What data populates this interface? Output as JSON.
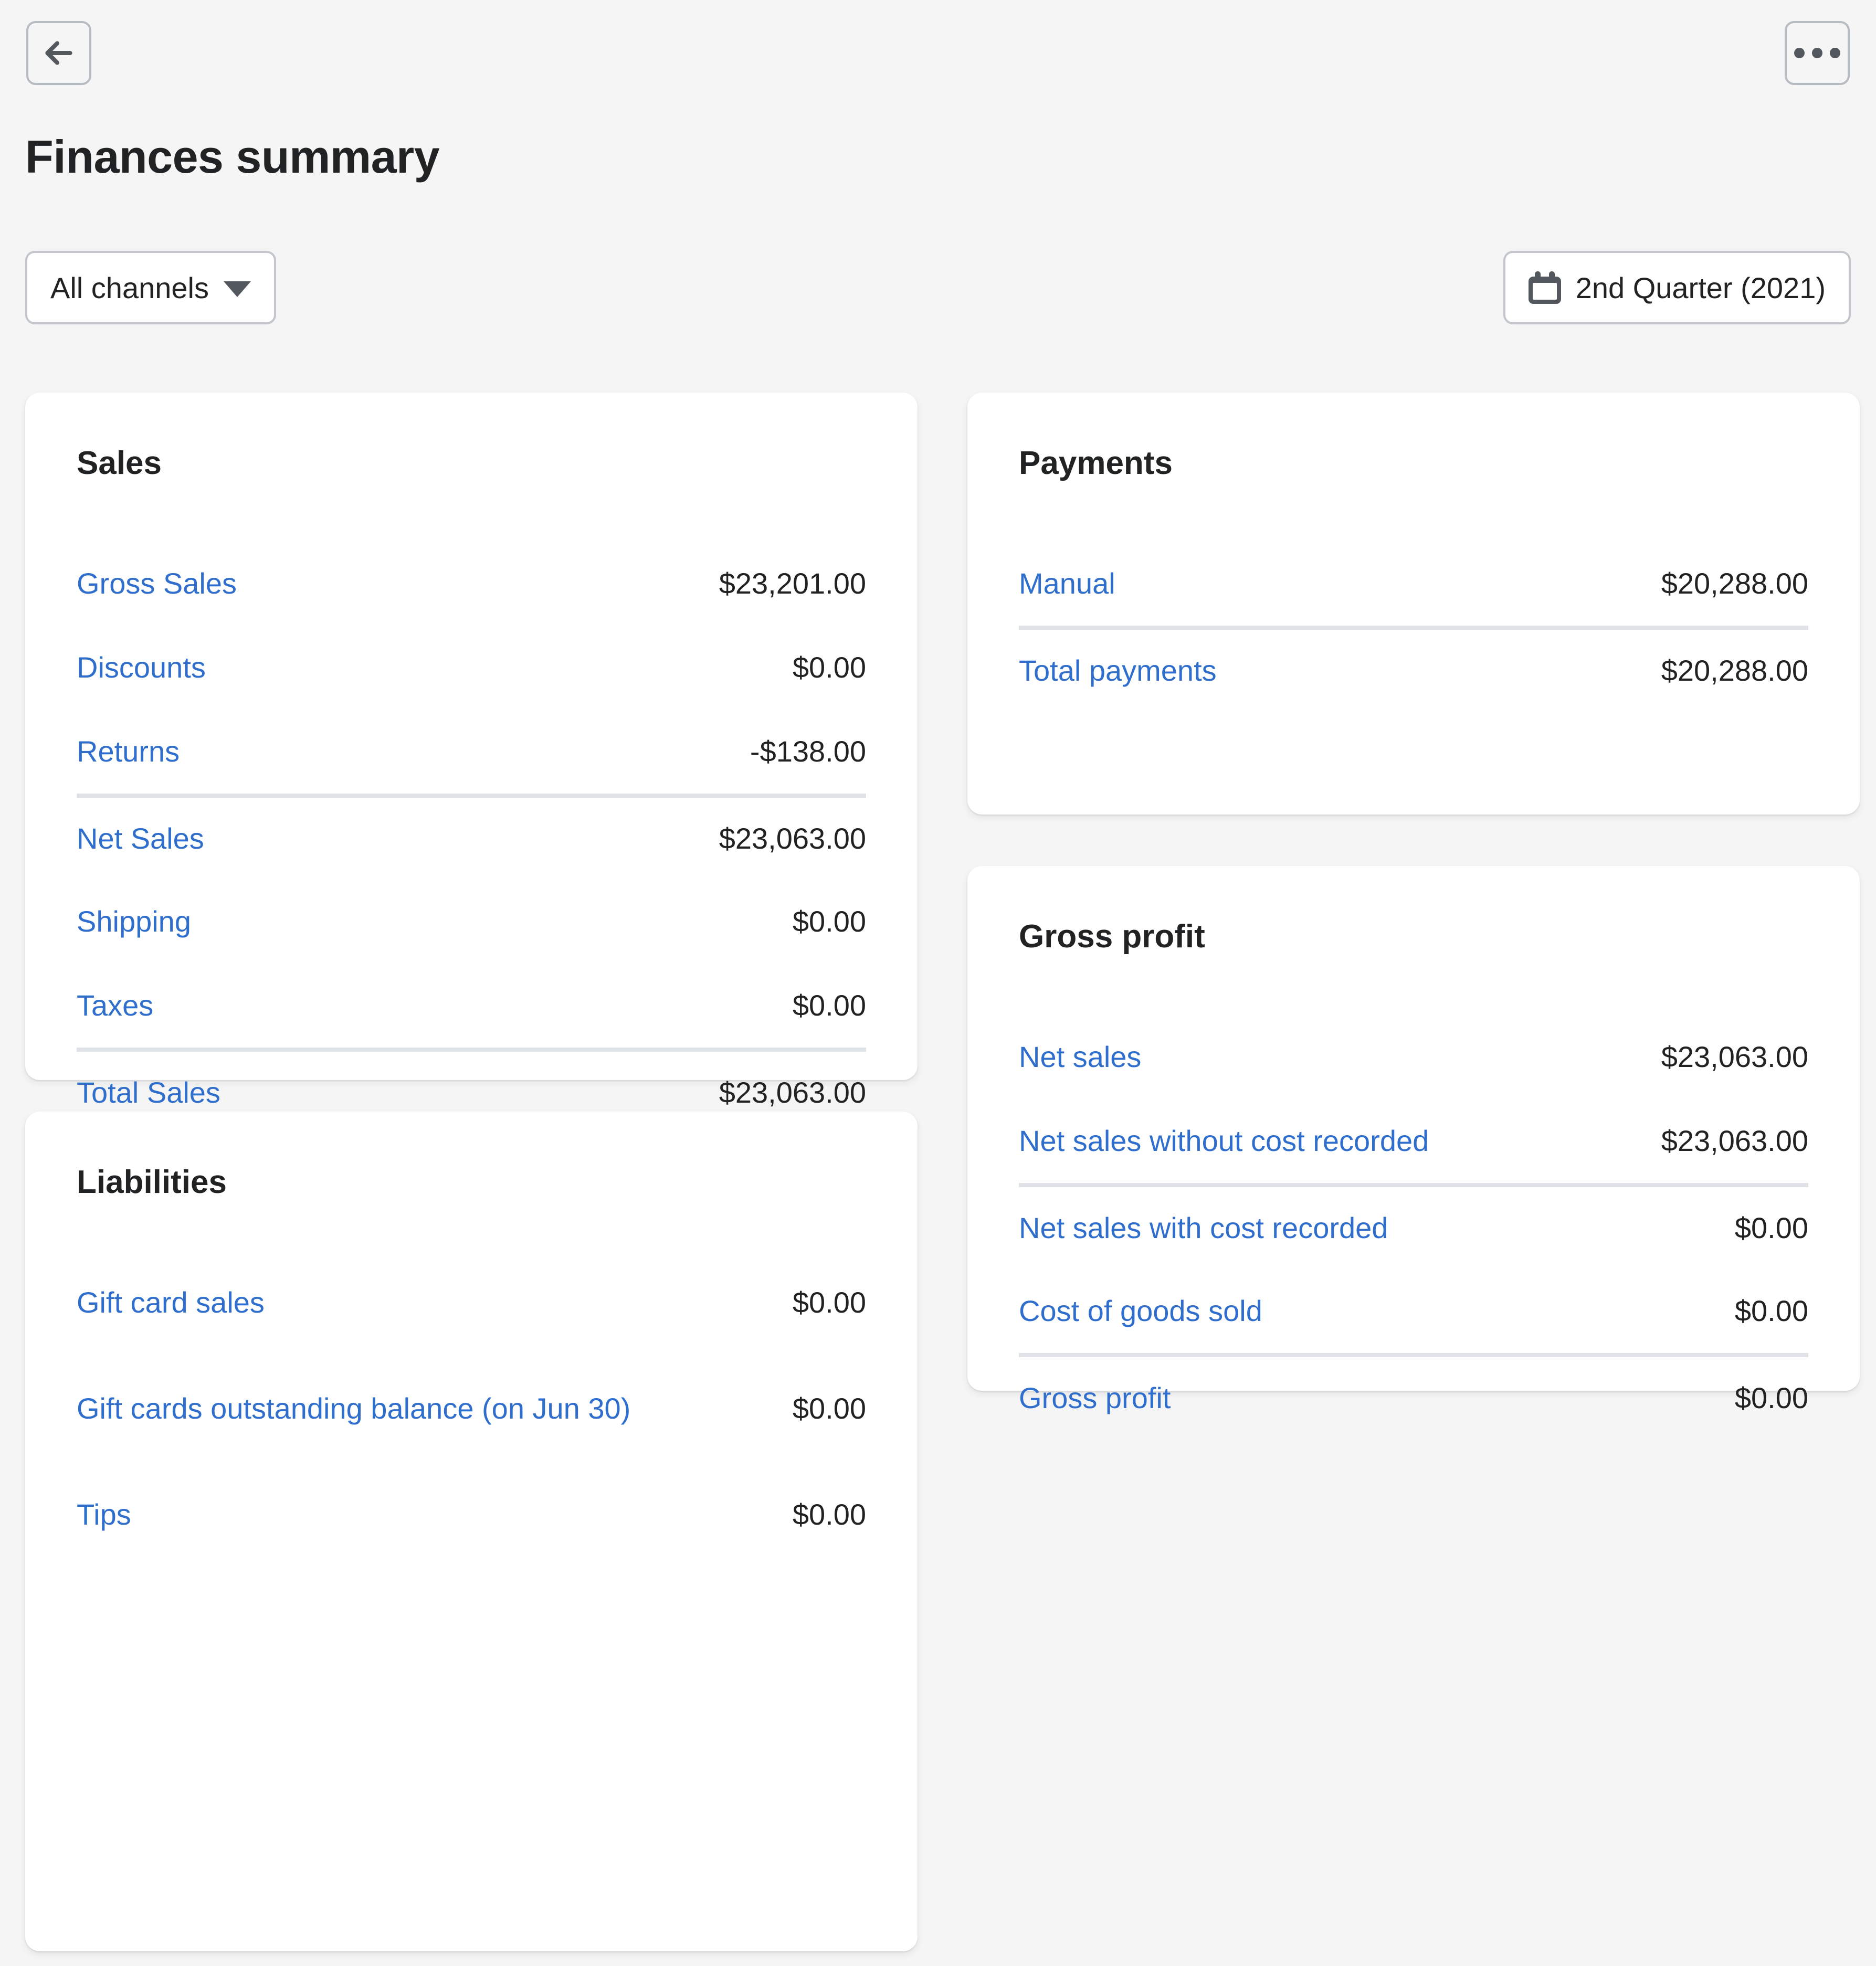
{
  "header": {
    "back_icon": "arrow-left-icon",
    "more_icon": "ellipsis-icon",
    "title": "Finances summary"
  },
  "filters": {
    "channel": {
      "label": "All channels",
      "caret_icon": "chevron-down-icon"
    },
    "date_range": {
      "label": "2nd Quarter (2021)",
      "calendar_icon": "calendar-icon"
    }
  },
  "colors": {
    "link": "#2f6ecc",
    "text": "#202223",
    "page_bg": "#f5f5f5",
    "card_bg": "#ffffff",
    "divider": "#dfe3e8",
    "border": "#c3c7cc"
  },
  "cards": {
    "sales": {
      "title": "Sales",
      "rows": [
        {
          "label": "Gross Sales",
          "value": "$23,201.00",
          "divider_before": false
        },
        {
          "label": "Discounts",
          "value": "$0.00",
          "divider_before": false
        },
        {
          "label": "Returns",
          "value": "-$138.00",
          "divider_before": false
        },
        {
          "label": "Net Sales",
          "value": "$23,063.00",
          "divider_before": true
        },
        {
          "label": "Shipping",
          "value": "$0.00",
          "divider_before": false
        },
        {
          "label": "Taxes",
          "value": "$0.00",
          "divider_before": false
        },
        {
          "label": "Total Sales",
          "value": "$23,063.00",
          "divider_before": true
        }
      ]
    },
    "payments": {
      "title": "Payments",
      "rows": [
        {
          "label": "Manual",
          "value": "$20,288.00",
          "divider_before": false
        },
        {
          "label": "Total payments",
          "value": "$20,288.00",
          "divider_before": true
        }
      ]
    },
    "gross_profit": {
      "title": "Gross profit",
      "rows": [
        {
          "label": "Net sales",
          "value": "$23,063.00",
          "divider_before": false
        },
        {
          "label": "Net sales without cost recorded",
          "value": "$23,063.00",
          "divider_before": false
        },
        {
          "label": "Net sales with cost recorded",
          "value": "$0.00",
          "divider_before": true
        },
        {
          "label": "Cost of goods sold",
          "value": "$0.00",
          "divider_before": false
        },
        {
          "label": "Gross profit",
          "value": "$0.00",
          "divider_before": true
        }
      ]
    },
    "liabilities": {
      "title": "Liabilities",
      "rows": [
        {
          "label": "Gift card sales",
          "value": "$0.00",
          "divider_before": false,
          "tall": false
        },
        {
          "label": "Gift cards outstanding balance (on Jun 30)",
          "value": "$0.00",
          "divider_before": false,
          "tall": true
        },
        {
          "label": "Tips",
          "value": "$0.00",
          "divider_before": false,
          "tall": false
        }
      ]
    }
  }
}
